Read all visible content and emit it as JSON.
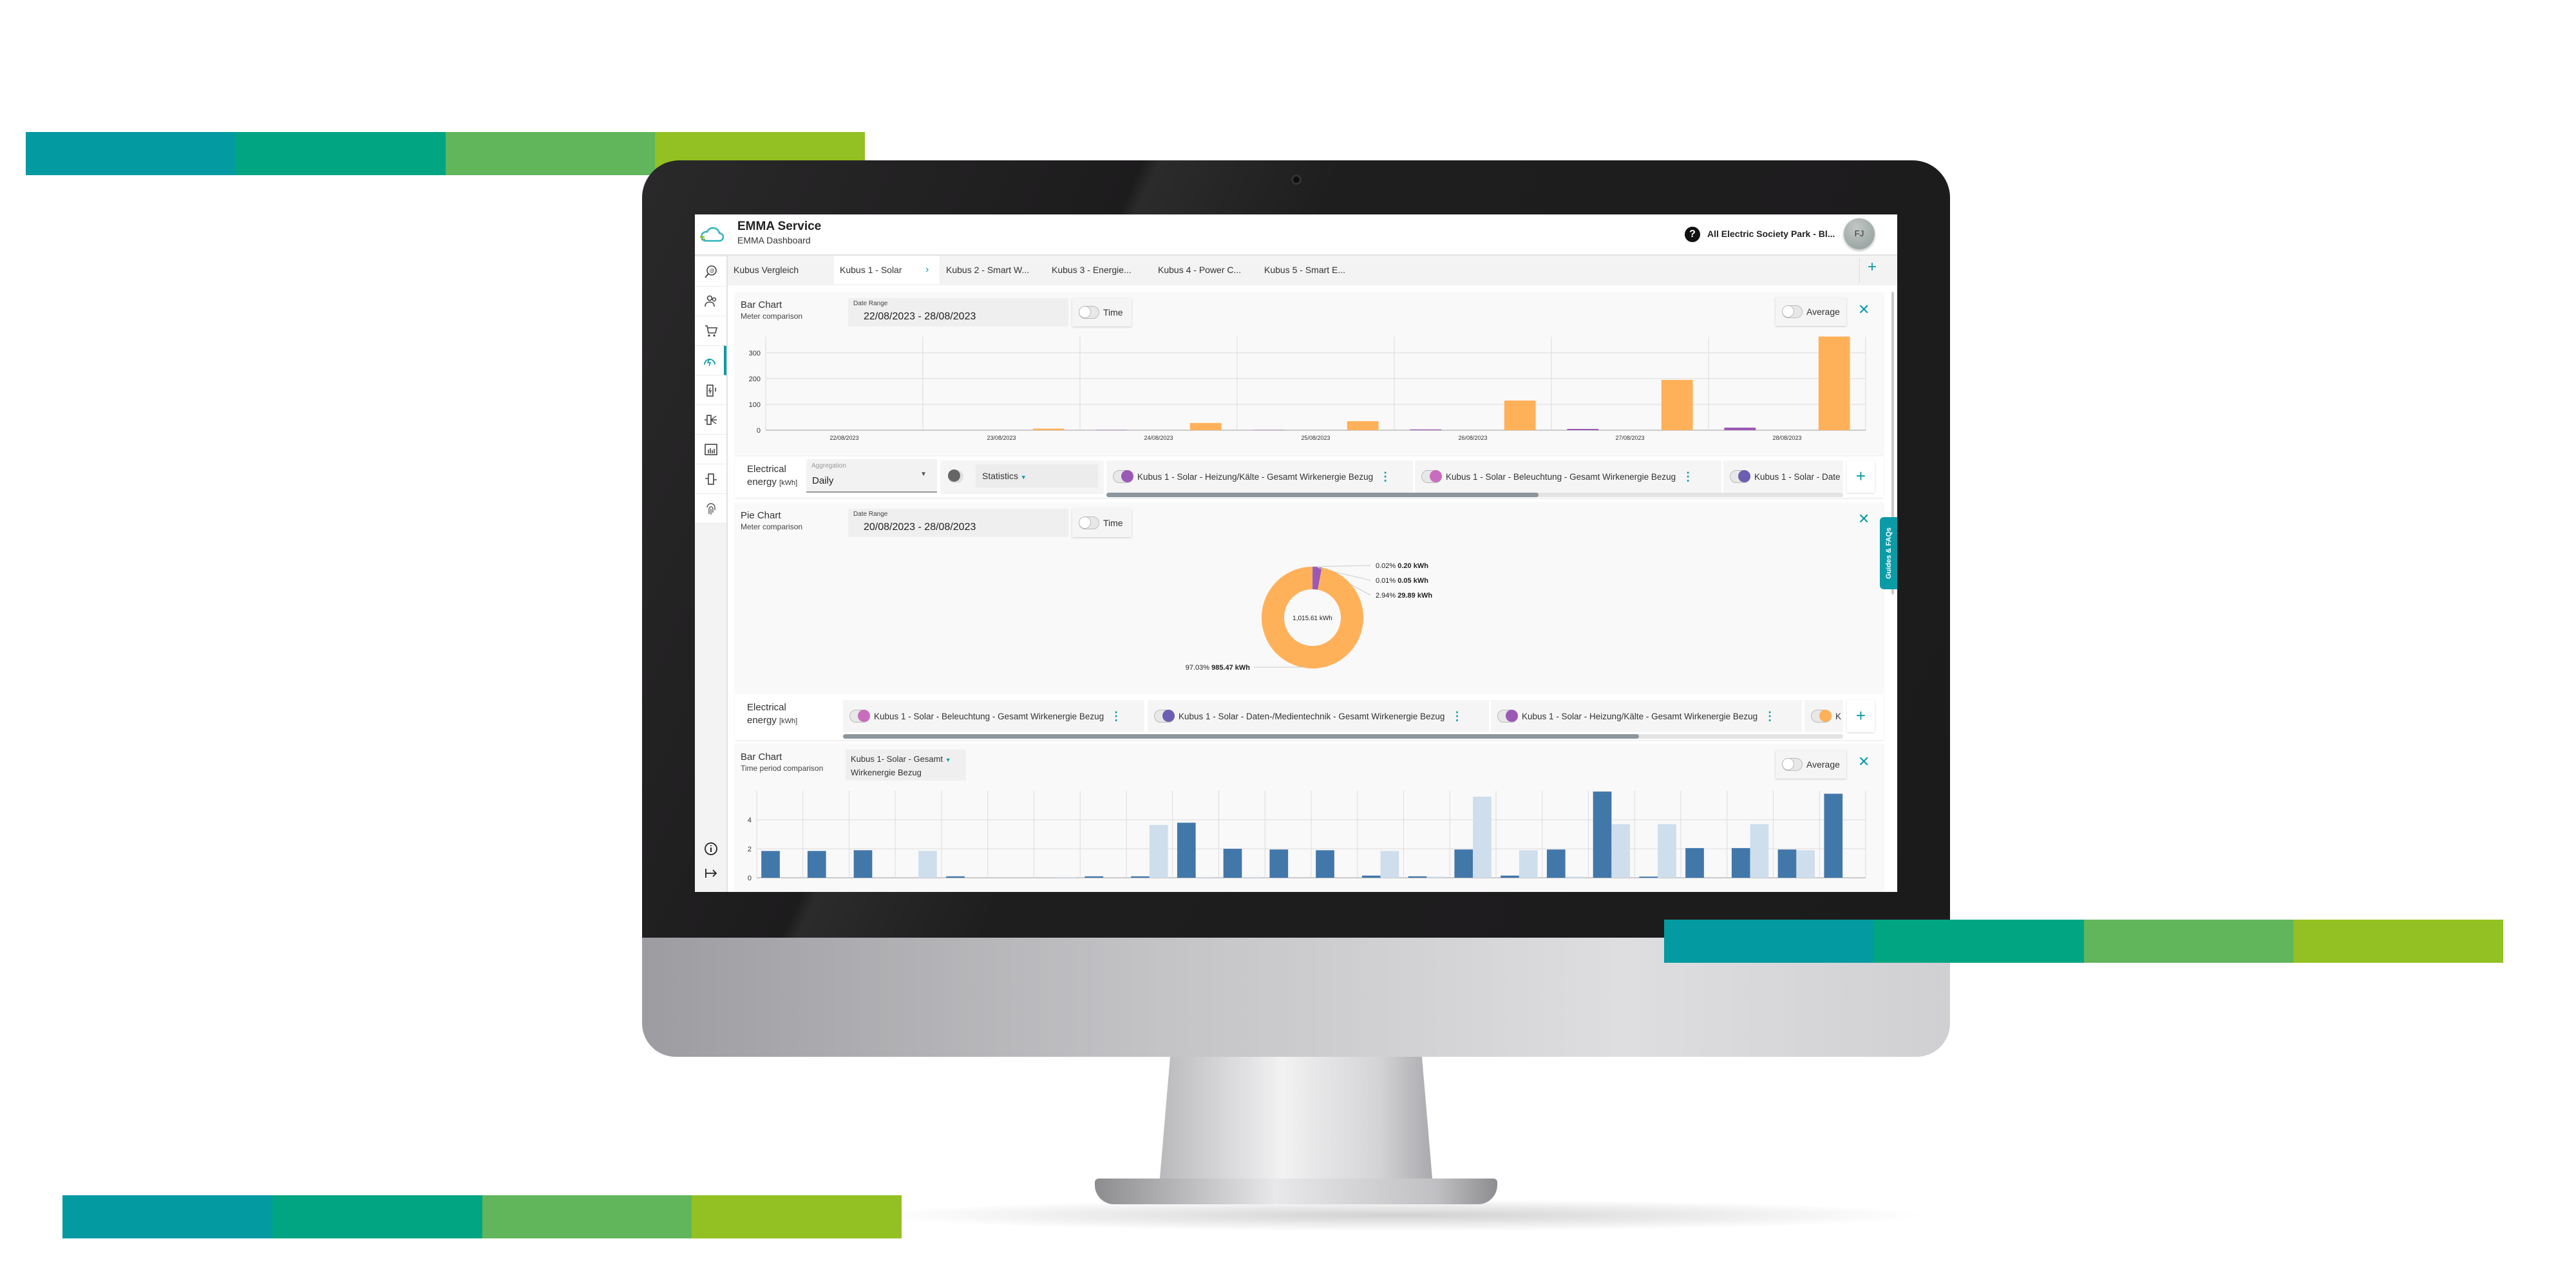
{
  "decor": {
    "stripe_colors": [
      "#049aa2",
      "#02a582",
      "#61b55b",
      "#93c022"
    ]
  },
  "header": {
    "title": "EMMA Service",
    "subtitle": "EMMA Dashboard",
    "site": "All Electric Society Park - Bl...",
    "avatar": "FJ",
    "help_icon": "question-circle-icon"
  },
  "sidebar": {
    "items": [
      {
        "icon": "meter-search-icon"
      },
      {
        "icon": "users-icon"
      },
      {
        "icon": "cart-icon"
      },
      {
        "icon": "energy-dashboard-icon",
        "active": true
      },
      {
        "icon": "battery-charge-icon"
      },
      {
        "icon": "connector-icon"
      },
      {
        "icon": "bar-chart-icon"
      },
      {
        "icon": "meter-device-icon"
      },
      {
        "icon": "fingerprint-icon"
      }
    ],
    "bottom": [
      {
        "icon": "info-icon"
      },
      {
        "icon": "logout-icon"
      }
    ]
  },
  "tabs": [
    {
      "label": "Kubus Vergleich"
    },
    {
      "label": "Kubus 1 - Solar",
      "active": true
    },
    {
      "label": "Kubus 2 - Smart W..."
    },
    {
      "label": "Kubus 3 - Energie..."
    },
    {
      "label": "Kubus 4 - Power C..."
    },
    {
      "label": "Kubus 5 - Smart E..."
    }
  ],
  "accent": "#0a9ba6",
  "bar_card": {
    "title": "Bar Chart",
    "subtitle": "Meter comparison",
    "date_label": "Date Range",
    "date_value": "22/08/2023 - 28/08/2023",
    "time_label": "Time",
    "average_label": "Average"
  },
  "legend1": {
    "title": "Electrical",
    "title2": "energy",
    "unit": "[kWh]",
    "aggregation_label": "Aggregation",
    "aggregation_value": "Daily",
    "statistics_label": "Statistics",
    "items": [
      {
        "label": "Kubus 1 - Solar - Heizung/Kälte - Gesamt Wirkenergie Bezug",
        "color": "#9b59b6"
      },
      {
        "label": "Kubus 1 - Solar - Beleuchtung - Gesamt Wirkenergie Bezug",
        "color": "#c86dbd"
      },
      {
        "label": "Kubus 1 - Solar - Date",
        "color": "#6a5fb0"
      }
    ]
  },
  "pie_card": {
    "title": "Pie Chart",
    "subtitle": "Meter comparison",
    "date_label": "Date Range",
    "date_value": "20/08/2023 - 28/08/2023",
    "time_label": "Time"
  },
  "legend2": {
    "title": "Electrical",
    "title2": "energy",
    "unit": "[kWh]",
    "items": [
      {
        "label": "Kubus 1 - Solar - Beleuchtung - Gesamt Wirkenergie Bezug",
        "color": "#c86dbd"
      },
      {
        "label": "Kubus 1 - Solar - Daten-/Medientechnik - Gesamt Wirkenergie Bezug",
        "color": "#6a5fb0"
      },
      {
        "label": "Kubus 1 - Solar - Heizung/Kälte - Gesamt Wirkenergie Bezug",
        "color": "#9b59b6"
      },
      {
        "label": "K",
        "color": "#ffb15a"
      }
    ]
  },
  "period_card": {
    "title": "Bar Chart",
    "subtitle": "Time period comparison",
    "meter_line1": "Kubus 1- Solar - Gesamt",
    "meter_line2": "Wirkenergie Bezug",
    "average_label": "Average"
  },
  "guides_label": "Guides & FAQs",
  "chart_data": [
    {
      "type": "bar",
      "title": "",
      "xlabel": "",
      "ylabel": "",
      "categories": [
        "22/08/2023",
        "23/08/2023",
        "24/08/2023",
        "25/08/2023",
        "26/08/2023",
        "27/08/2023",
        "28/08/2023"
      ],
      "yticks": [
        0,
        100,
        200,
        300
      ],
      "ylim": [
        0,
        362
      ],
      "grid": true,
      "series": [
        {
          "color": "#9b59b6",
          "values": [
            0,
            0,
            1,
            1,
            3,
            5,
            10
          ]
        },
        {
          "color": "#c86dbd",
          "values": [
            0,
            0,
            0,
            0,
            0,
            0,
            0
          ]
        },
        {
          "color": "#6a5fb0",
          "values": [
            0,
            0,
            0,
            0,
            0,
            0,
            0
          ]
        },
        {
          "color": "#ffb15a",
          "values": [
            0,
            6,
            28,
            35,
            115,
            195,
            363
          ]
        }
      ]
    },
    {
      "type": "pie",
      "donut": true,
      "center_label": "1,015.61 kWh",
      "slices": [
        {
          "percent": 0.02,
          "value": 0.2,
          "pct_label": "0.02%",
          "val_label": "0.20 kWh",
          "color": "#c86dbd"
        },
        {
          "percent": 0.01,
          "value": 0.05,
          "pct_label": "0.01%",
          "val_label": "0.05 kWh",
          "color": "#6a5fb0"
        },
        {
          "percent": 2.94,
          "value": 29.89,
          "pct_label": "2.94%",
          "val_label": "29.89 kWh",
          "color": "#9b59b6"
        },
        {
          "percent": 97.03,
          "value": 985.47,
          "pct_label": "97.03%",
          "val_label": "985.47 kWh",
          "color": "#ffb15a"
        }
      ]
    },
    {
      "type": "bar",
      "title": "",
      "xlabel": "",
      "ylabel": "",
      "yticks": [
        0,
        2,
        4
      ],
      "ylim": [
        0,
        6
      ],
      "grid": true,
      "series": [
        {
          "color": "#4277aa",
          "values": [
            1.85,
            1.85,
            1.9,
            0,
            0.1,
            0,
            0,
            0.1,
            0.1,
            3.8,
            2.0,
            1.95,
            1.9,
            0.15,
            0.1,
            1.95,
            0.15,
            1.95,
            5.95,
            0.08,
            2.05,
            2.05,
            1.95,
            5.8
          ]
        },
        {
          "color": "#cfdeec",
          "values": [
            0,
            0,
            0,
            1.85,
            0,
            0,
            0.05,
            0,
            3.65,
            0.05,
            0.05,
            0,
            0,
            1.85,
            0.08,
            5.6,
            1.9,
            0.08,
            3.7,
            3.7,
            0,
            3.7,
            1.9,
            0
          ]
        }
      ]
    }
  ]
}
